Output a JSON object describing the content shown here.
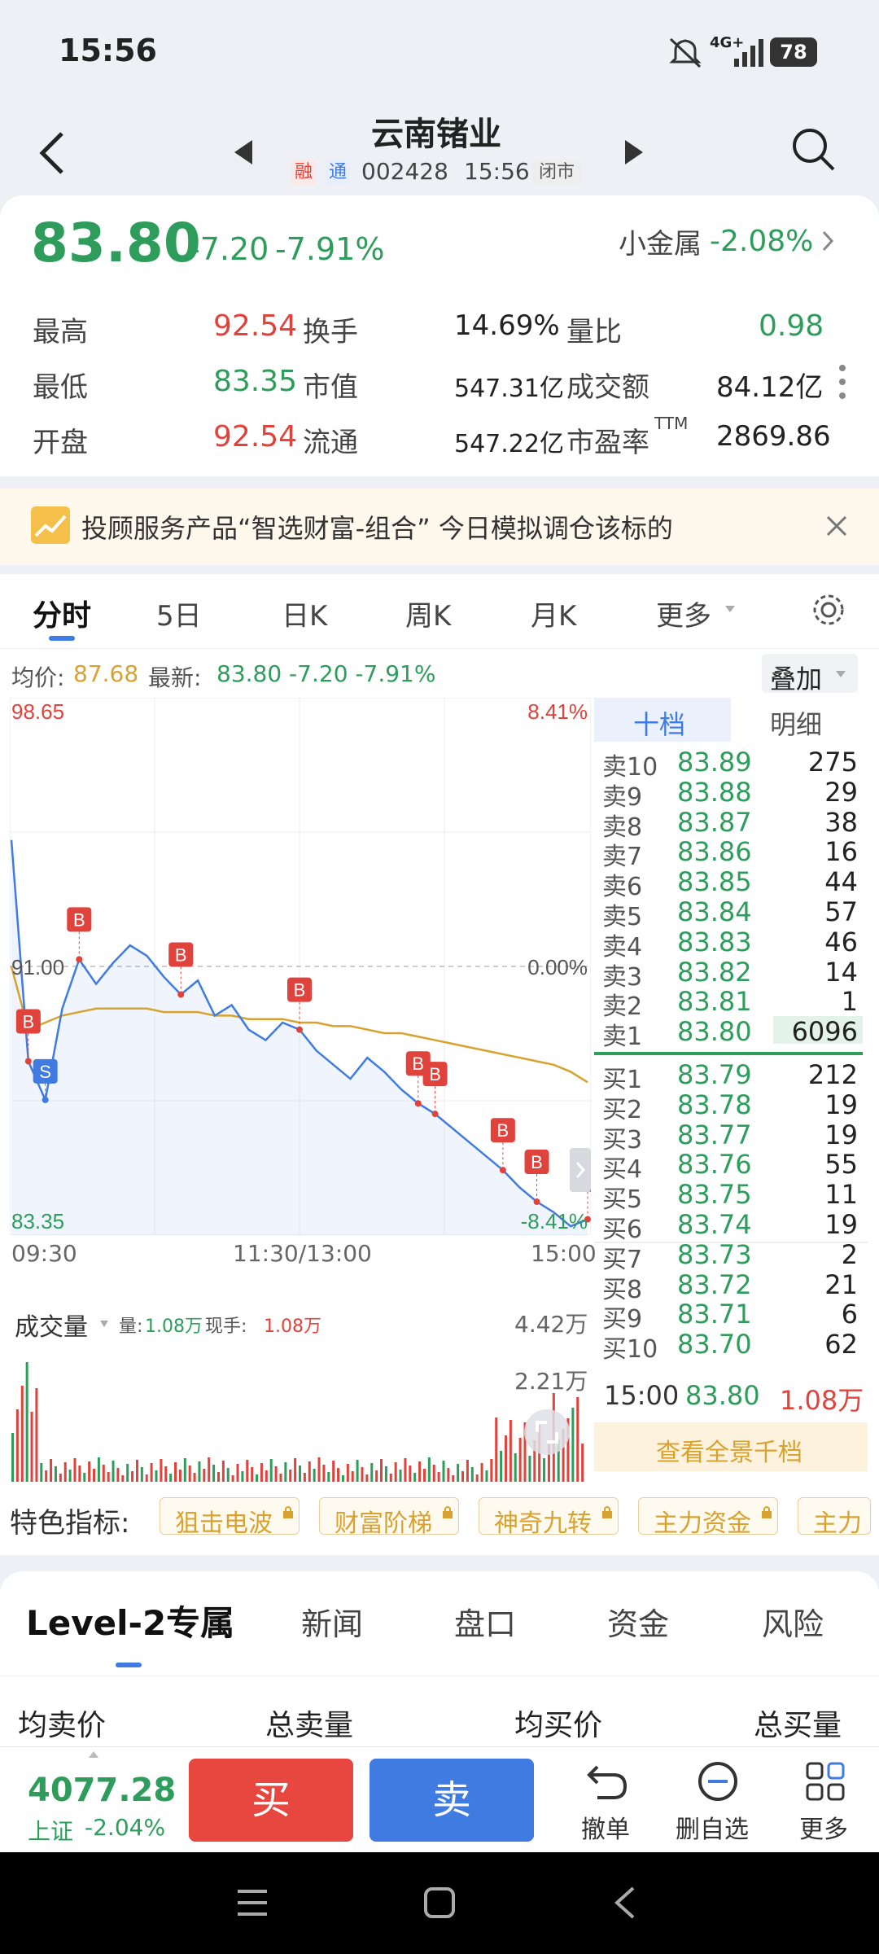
{
  "status": {
    "time": "15:56",
    "network": "4G+",
    "battery": "78"
  },
  "header": {
    "stock_name": "云南锗业",
    "tag_rong": "融",
    "tag_tong": "通",
    "code": "002428",
    "time": "15:56",
    "market_state": "闭市"
  },
  "quote": {
    "price": "83.80",
    "change": "-7.20",
    "change_pct": "-7.91%",
    "sector": "小金属",
    "sector_pct": "-2.08%"
  },
  "stats": {
    "high_label": "最高",
    "high": "92.54",
    "turnover_label": "换手",
    "turnover": "14.69%",
    "vol_ratio_label": "量比",
    "vol_ratio": "0.98",
    "low_label": "最低",
    "low": "83.35",
    "mktcap_label": "市值",
    "mktcap": "547.31亿",
    "amount_label": "成交额",
    "amount": "84.12亿",
    "open_label": "开盘",
    "open": "92.54",
    "float_label": "流通",
    "float": "547.22亿",
    "pe_label": "市盈率",
    "pe_sup": "TTM",
    "pe": "2869.86"
  },
  "banner": {
    "text": "投顾服务产品“智选财富-组合” 今日模拟调仓该标的"
  },
  "chart_tabs": [
    "分时",
    "5日",
    "日K",
    "周K",
    "月K",
    "更多"
  ],
  "chart_info": {
    "avg_label": "均价:",
    "avg": "87.68",
    "latest_label": "最新:",
    "latest": "83.80 -7.20 -7.91%",
    "overlay": "叠加"
  },
  "chart_data": {
    "type": "line",
    "y_left_ticks": [
      "98.65",
      "91.00",
      "83.35"
    ],
    "y_right_ticks": [
      "8.41%",
      "0.00%",
      "-8.41%"
    ],
    "x_labels": [
      "09:30",
      "11:30/13:00",
      "15:00"
    ],
    "ylim": [
      83.35,
      98.65
    ],
    "prev_close": 91.0,
    "series": [
      {
        "values": [
          94.6,
          88.3,
          87.2,
          89.8,
          91.2,
          90.5,
          91.1,
          91.6,
          91.3,
          90.7,
          90.2,
          90.6,
          89.6,
          89.9,
          89.2,
          88.9,
          89.4,
          89.2,
          88.6,
          88.2,
          87.8,
          88.4,
          88.0,
          87.5,
          87.1,
          86.8,
          86.4,
          86.0,
          85.6,
          85.2,
          84.7,
          84.3,
          84.0,
          83.6,
          83.8
        ]
      },
      {
        "values": [
          91.0,
          89.2,
          89.4,
          89.6,
          89.7,
          89.8,
          89.8,
          89.8,
          89.8,
          89.7,
          89.7,
          89.7,
          89.6,
          89.6,
          89.5,
          89.5,
          89.5,
          89.4,
          89.4,
          89.3,
          89.3,
          89.2,
          89.1,
          89.1,
          89.0,
          88.9,
          88.8,
          88.7,
          88.6,
          88.5,
          88.4,
          88.3,
          88.2,
          88.0,
          87.7
        ]
      }
    ],
    "markers": [
      {
        "label": "S",
        "i": 2
      },
      {
        "label": "B",
        "i": 1
      },
      {
        "label": "B",
        "i": 4
      },
      {
        "label": "B",
        "i": 10
      },
      {
        "label": "B",
        "i": 17
      },
      {
        "label": "B",
        "i": 24
      },
      {
        "label": "B",
        "i": 25
      },
      {
        "label": "B",
        "i": 29
      },
      {
        "label": "B",
        "i": 31
      },
      {
        "label": "B",
        "i": 34
      }
    ],
    "volume": {
      "label": "成交量",
      "vol_label": "量:",
      "vol": "1.08万",
      "cur_label": "现手:",
      "cur": "1.08万",
      "max": "4.42万",
      "mid": "2.21万"
    }
  },
  "orderbook": {
    "tab_active": "十档",
    "tab_other": "明细",
    "sells": [
      {
        "label": "卖10",
        "price": "83.89",
        "vol": "275"
      },
      {
        "label": "卖9",
        "price": "83.88",
        "vol": "29"
      },
      {
        "label": "卖8",
        "price": "83.87",
        "vol": "38"
      },
      {
        "label": "卖7",
        "price": "83.86",
        "vol": "16"
      },
      {
        "label": "卖6",
        "price": "83.85",
        "vol": "44"
      },
      {
        "label": "卖5",
        "price": "83.84",
        "vol": "57"
      },
      {
        "label": "卖4",
        "price": "83.83",
        "vol": "46"
      },
      {
        "label": "卖3",
        "price": "83.82",
        "vol": "14"
      },
      {
        "label": "卖2",
        "price": "83.81",
        "vol": "1"
      },
      {
        "label": "卖1",
        "price": "83.80",
        "vol": "6096"
      }
    ],
    "buys": [
      {
        "label": "买1",
        "price": "83.79",
        "vol": "212"
      },
      {
        "label": "买2",
        "price": "83.78",
        "vol": "19"
      },
      {
        "label": "买3",
        "price": "83.77",
        "vol": "19"
      },
      {
        "label": "买4",
        "price": "83.76",
        "vol": "55"
      },
      {
        "label": "买5",
        "price": "83.75",
        "vol": "11"
      },
      {
        "label": "买6",
        "price": "83.74",
        "vol": "19"
      },
      {
        "label": "买7",
        "price": "83.73",
        "vol": "2"
      },
      {
        "label": "买8",
        "price": "83.72",
        "vol": "21"
      },
      {
        "label": "买9",
        "price": "83.71",
        "vol": "6"
      },
      {
        "label": "买10",
        "price": "83.70",
        "vol": "62"
      }
    ],
    "last_trade": {
      "time": "15:00",
      "price": "83.80",
      "vol": "1.08万"
    },
    "view_all": "查看全景千档"
  },
  "indicators": {
    "label": "特色指标:",
    "items": [
      "狙击电波",
      "财富阶梯",
      "神奇九转",
      "主力资金",
      "主力"
    ]
  },
  "section_tabs": [
    "Level-2专属",
    "新闻",
    "盘口",
    "资金",
    "风险"
  ],
  "level2_headers": [
    "均卖价",
    "总卖量",
    "均买价",
    "总买量"
  ],
  "bottom": {
    "index_value": "4077.28",
    "index_name": "上证",
    "index_pct": "-2.04%",
    "buy": "买",
    "sell": "卖",
    "cancel": "撤单",
    "remove": "删自选",
    "more": "更多"
  },
  "colors": {
    "green": "#2e9d5c",
    "red": "#e0433b",
    "blue": "#3f7be0",
    "gold": "#d7a22f"
  }
}
